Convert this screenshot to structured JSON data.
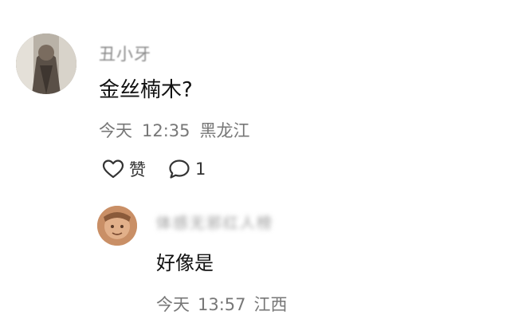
{
  "main_comment": {
    "username": "丑小牙",
    "content": "金丝楠木?",
    "date": "今天",
    "time": "12:35",
    "location": "黑龙江",
    "like_label": "赞",
    "reply_count": "1",
    "like_icon": "heart-outline-icon",
    "reply_icon": "comment-bubble-icon"
  },
  "reply": {
    "username": "体感无邪红人榜",
    "content": "好像是",
    "date": "今天",
    "time": "13:57",
    "location": "江西"
  }
}
